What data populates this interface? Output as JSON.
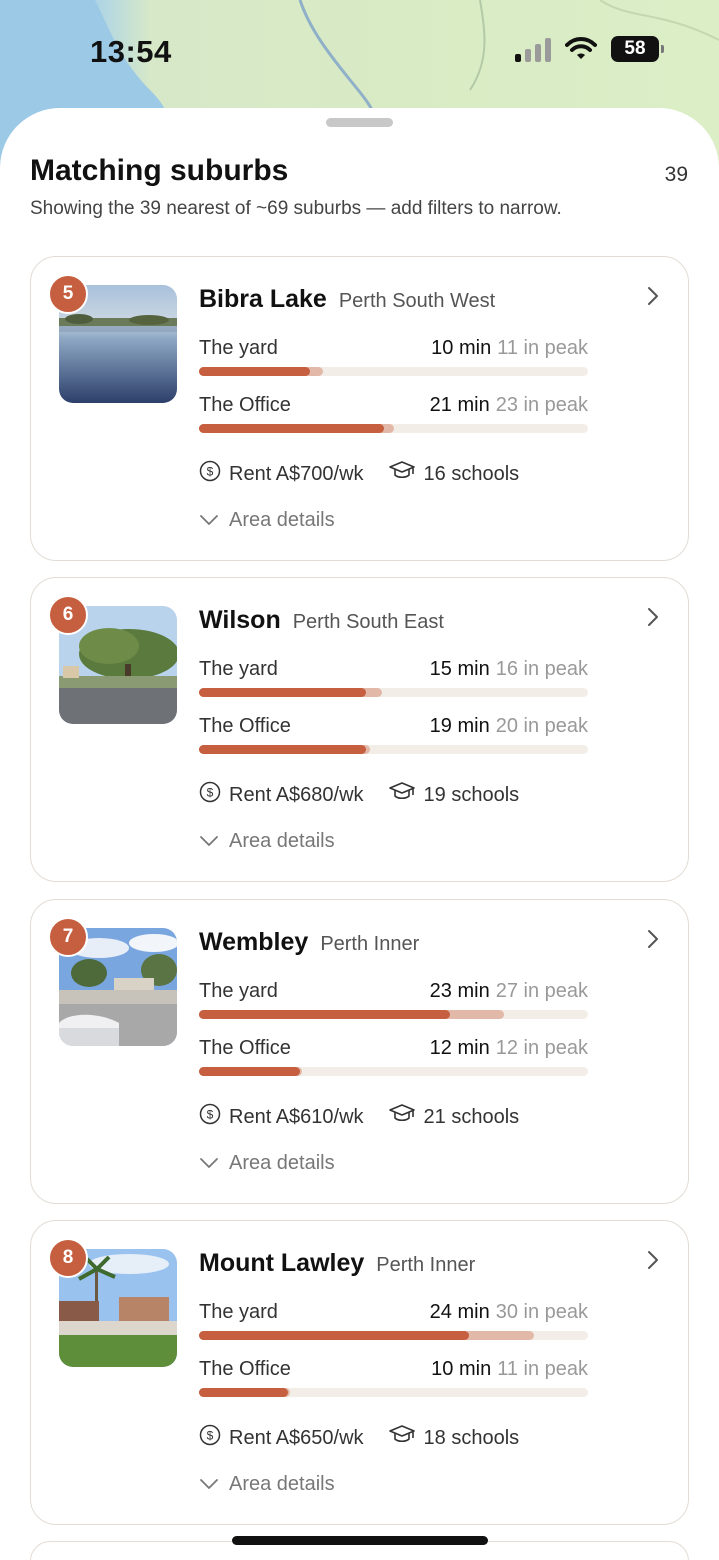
{
  "status": {
    "time": "13:54",
    "battery": "58"
  },
  "header": {
    "title": "Matching suburbs",
    "count": "39",
    "subtitle": "Showing the 39 nearest of ~69 suburbs — add filters to narrow."
  },
  "colors": {
    "accent": "#c65f3f",
    "peak": "#e2b9a9",
    "track": "#f3ede8"
  },
  "cards": [
    {
      "rank": "5",
      "name": "Bibra Lake",
      "region": "Perth South West",
      "commutes": [
        {
          "label": "The yard",
          "min": "10 min",
          "peak": "11 in peak",
          "fill": 0.285,
          "peak_fill": 0.32
        },
        {
          "label": "The Office",
          "min": "21 min",
          "peak": "23 in peak",
          "fill": 0.475,
          "peak_fill": 0.5
        }
      ],
      "rent": "Rent A$700/wk",
      "schools": "16 schools",
      "details": "Area details",
      "photo": "lake"
    },
    {
      "rank": "6",
      "name": "Wilson",
      "region": "Perth South East",
      "commutes": [
        {
          "label": "The yard",
          "min": "15 min",
          "peak": "16 in peak",
          "fill": 0.43,
          "peak_fill": 0.47
        },
        {
          "label": "The Office",
          "min": "19 min",
          "peak": "20 in peak",
          "fill": 0.43,
          "peak_fill": 0.44
        }
      ],
      "rent": "Rent A$680/wk",
      "schools": "19 schools",
      "details": "Area details",
      "photo": "tree"
    },
    {
      "rank": "7",
      "name": "Wembley",
      "region": "Perth Inner",
      "commutes": [
        {
          "label": "The yard",
          "min": "23 min",
          "peak": "27 in peak",
          "fill": 0.645,
          "peak_fill": 0.785
        },
        {
          "label": "The Office",
          "min": "12 min",
          "peak": "12 in peak",
          "fill": 0.26,
          "peak_fill": 0.265
        }
      ],
      "rent": "Rent A$610/wk",
      "schools": "21 schools",
      "details": "Area details",
      "photo": "street"
    },
    {
      "rank": "8",
      "name": "Mount Lawley",
      "region": "Perth Inner",
      "commutes": [
        {
          "label": "The yard",
          "min": "24 min",
          "peak": "30 in peak",
          "fill": 0.695,
          "peak_fill": 0.86
        },
        {
          "label": "The Office",
          "min": "10 min",
          "peak": "11 in peak",
          "fill": 0.23,
          "peak_fill": 0.235
        }
      ],
      "rent": "Rent A$650/wk",
      "schools": "18 schools",
      "details": "Area details",
      "photo": "palms"
    }
  ]
}
